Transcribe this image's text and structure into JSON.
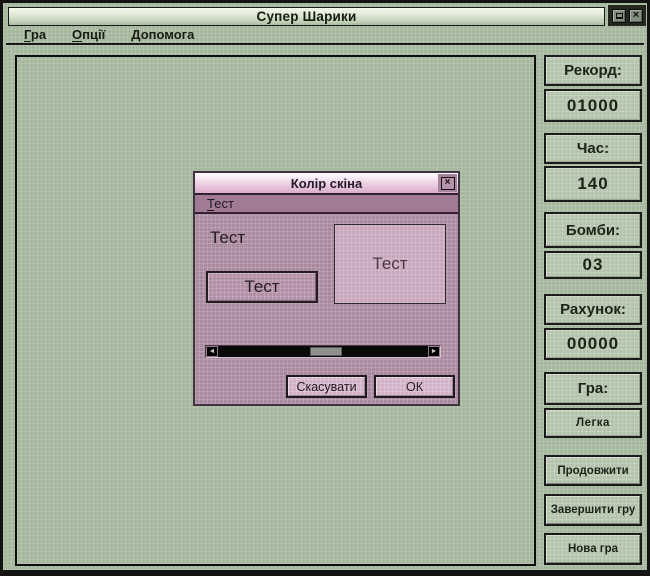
{
  "window": {
    "title": "Супер Шарики",
    "icons": {
      "close": "×",
      "scroll_left": "◄",
      "scroll_right": "►"
    }
  },
  "menubar": {
    "items": [
      {
        "accel": "Г",
        "rest": "ра"
      },
      {
        "accel": "О",
        "rest": "пції"
      },
      {
        "accel": "Д",
        "rest": "опомога"
      }
    ]
  },
  "sidebar": {
    "groups": [
      {
        "label": "Рекорд:",
        "value": "01000"
      },
      {
        "label": "Час:",
        "value": "140"
      },
      {
        "label": "Бомби:",
        "value": "03"
      },
      {
        "label": "Рахунок:",
        "value": "00000"
      },
      {
        "label": "Гра:",
        "value": "Легка"
      }
    ],
    "buttons": [
      {
        "label": "Продовжити"
      },
      {
        "label": "Завершити гру"
      },
      {
        "label": "Нова гра"
      }
    ]
  },
  "dialog": {
    "title": "Колір скіна",
    "menu": {
      "accel": "Т",
      "rest": "ест"
    },
    "test_label": "Тест",
    "test_button": "Тест",
    "preview_label": "Тест",
    "scrollbar": {
      "thumb_left_percent": 44,
      "thumb_width_percent": 15
    },
    "cancel_button": "Скасувати",
    "ok_button": "ОК"
  },
  "colors": {
    "window_green": "#a5b79d",
    "panel_green": "#b4c4ac",
    "titlebar_light": "#f4f8ee",
    "dialog_mauve": "#a98aa0",
    "dialog_title_pink": "#e7c3da",
    "dialog_menu_mauve": "#a17b96",
    "dialog_button_pink": "#d2b2c8",
    "preview_pink": "#c9a9bf",
    "scrollbar_track": "#0a0a0a",
    "scrollbar_thumb": "#8f8f8f"
  }
}
